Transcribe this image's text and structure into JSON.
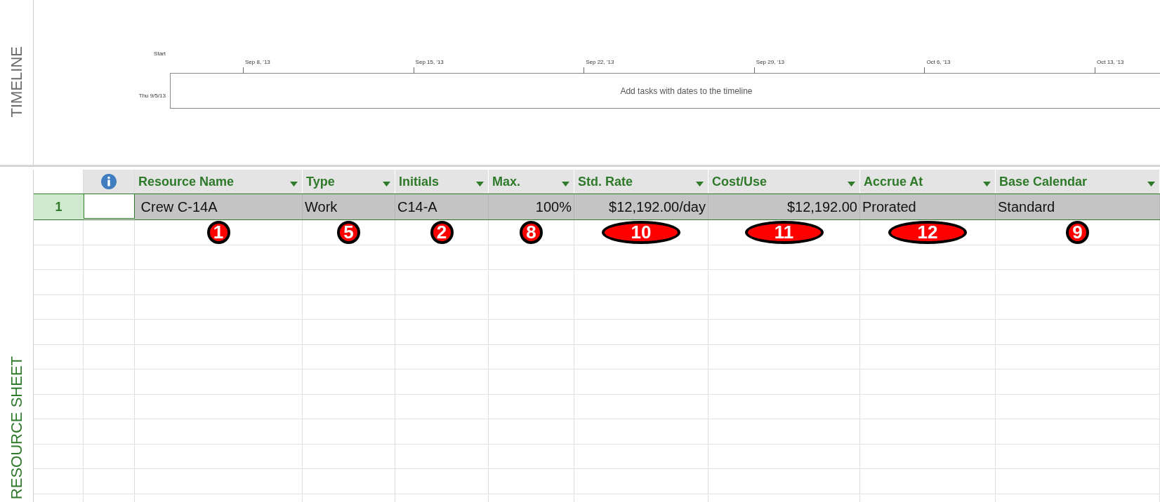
{
  "timeline": {
    "label": "TIMELINE",
    "start_label": "Start",
    "start_date": "Thu 9/5/13",
    "ticks": [
      "Sep 8, '13",
      "Sep 15, '13",
      "Sep 22, '13",
      "Sep 29, '13",
      "Oct 6, '13",
      "Oct 13, '13"
    ],
    "placeholder": "Add tasks with dates to the timeline"
  },
  "sheet": {
    "label": "RESOURCE SHEET",
    "columns": [
      {
        "title": "Resource Name",
        "kind": "text"
      },
      {
        "title": "Type",
        "kind": "text"
      },
      {
        "title": "Initials",
        "kind": "text"
      },
      {
        "title": "Max.",
        "kind": "number"
      },
      {
        "title": "Std. Rate",
        "kind": "number"
      },
      {
        "title": "Cost/Use",
        "kind": "number"
      },
      {
        "title": "Accrue At",
        "kind": "text"
      },
      {
        "title": "Base Calendar",
        "kind": "text"
      }
    ],
    "rows": [
      {
        "number": "1",
        "selected": true,
        "cells": [
          " Crew C-14A",
          "Work",
          "C14-A",
          "100%",
          "$12,192.00/day",
          "$12,192.00",
          "Prorated",
          "Standard"
        ]
      }
    ],
    "markers": [
      {
        "label": "1",
        "kind": "circle"
      },
      {
        "label": "5",
        "kind": "circle"
      },
      {
        "label": "2",
        "kind": "circle"
      },
      {
        "label": "8",
        "kind": "circle"
      },
      {
        "label": "10",
        "kind": "ellipse"
      },
      {
        "label": "11",
        "kind": "ellipse"
      },
      {
        "label": "12",
        "kind": "ellipse"
      },
      {
        "label": "9",
        "kind": "circle"
      }
    ]
  }
}
